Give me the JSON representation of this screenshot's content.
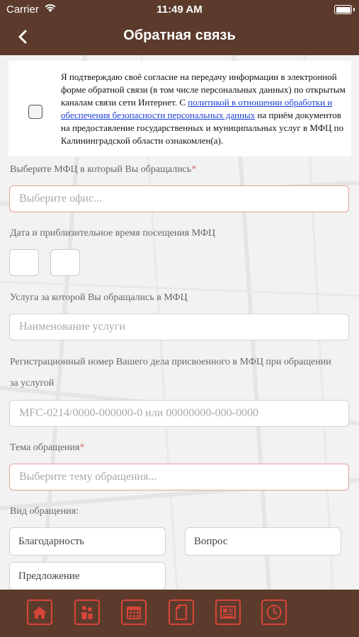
{
  "status_bar": {
    "carrier": "Carrier",
    "time": "11:49 AM"
  },
  "nav": {
    "title": "Обратная связь"
  },
  "consent": {
    "text_before": "Я подтверждаю своё согласие на передачу информации в электронной форме обратной связи (в том числе персональных данных) по открытым каналам связи сети Интернет. С ",
    "link_text": "политикой в отношении обработки и обеспечения безопасности персональных данных",
    "text_after": " на приём документов на предоставление государственных и муниципальных услуг в МФЦ по Калининградской области ознакомлен(а)."
  },
  "form": {
    "office_label": "Выберите МФЦ в который Вы обращались",
    "office_placeholder": "Выберите офис...",
    "date_label": "Дата и приблизительное время посещения МФЦ",
    "service_label": "Услуга за которой Вы обращались в МФЦ",
    "service_placeholder": "Наименование услуги",
    "regnum_label_line1": "Регистрационный номер Вашего дела присвоенного в МФЦ при обращении",
    "regnum_label_line2": "за услугой",
    "regnum_placeholder": "MFC-0214/0000-000000-0 или 00000000-000-0000",
    "topic_label": "Тема обращения",
    "topic_placeholder": "Выберите тему обращения...",
    "kind_label": "Вид обращения:",
    "required_mark": "*",
    "kind_options": [
      "Благодарность",
      "Вопрос",
      "Предложение"
    ]
  },
  "tab_bar": {
    "icons": [
      "home-icon",
      "people-icon",
      "calendar-icon",
      "document-icon",
      "newspaper-icon",
      "clock-icon"
    ],
    "accent_color": "#d8453a"
  },
  "colors": {
    "brand": "#5c3b2c",
    "required_border": "#e8a09a",
    "link": "#1a3fd6"
  }
}
